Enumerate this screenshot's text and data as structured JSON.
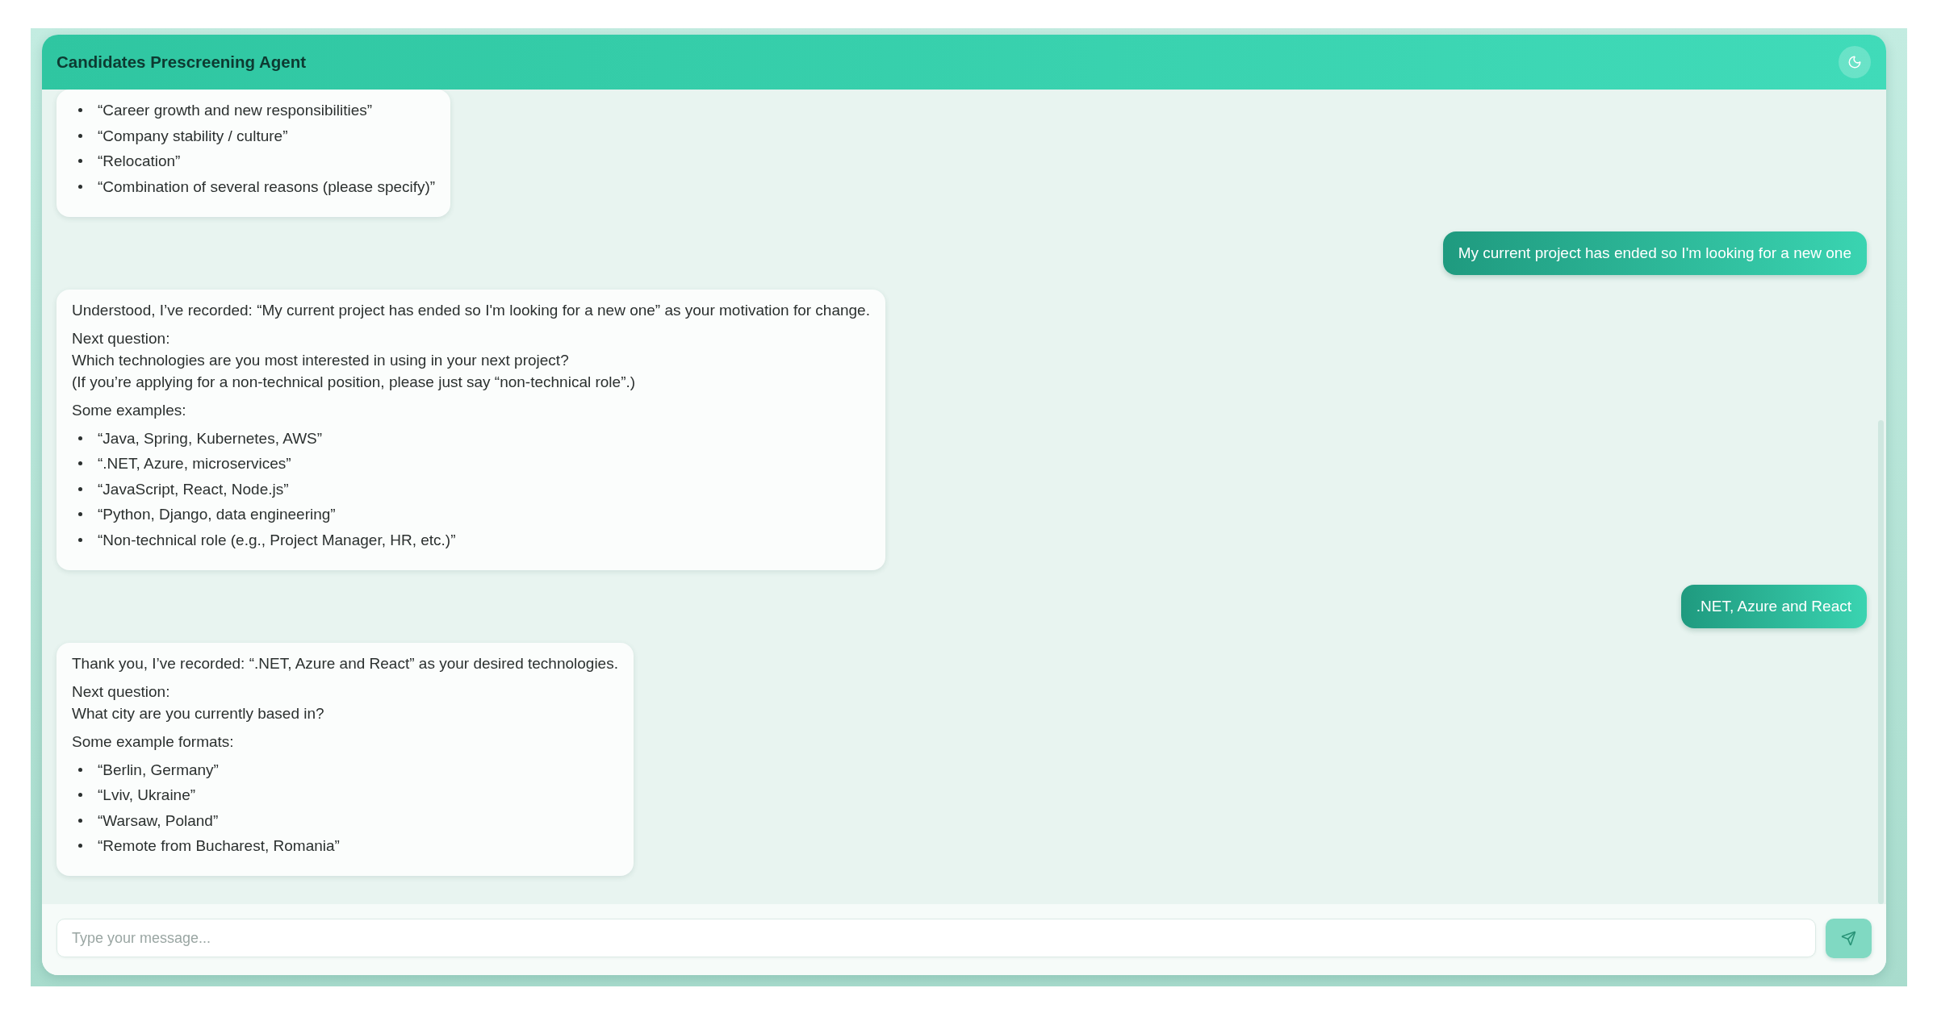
{
  "window": {
    "title": "Candidates Prescreening Agent"
  },
  "messages": [
    {
      "kind": "agent",
      "blocks": [
        {
          "kind": "list",
          "items": [
            "“Career growth and new responsibilities”",
            "“Company stability / culture”",
            "“Relocation”",
            "“Combination of several reasons (please specify)”"
          ]
        }
      ]
    },
    {
      "kind": "user",
      "text": "My current project has ended so I'm looking for a new one"
    },
    {
      "kind": "agent",
      "blocks": [
        {
          "kind": "paragraph",
          "lines": [
            "Understood, I’ve recorded: “My current project has ended so I'm looking for a new one” as your motivation for change."
          ]
        },
        {
          "kind": "paragraph",
          "lines": [
            "Next question:",
            "Which technologies are you most interested in using in your next project?",
            "(If you’re applying for a non-technical position, please just say “non-technical role”.)"
          ]
        },
        {
          "kind": "paragraph",
          "lines": [
            "Some examples:"
          ]
        },
        {
          "kind": "list",
          "items": [
            "“Java, Spring, Kubernetes, AWS”",
            "“.NET, Azure, microservices”",
            "“JavaScript, React, Node.js”",
            "“Python, Django, data engineering”",
            "“Non-technical role (e.g., Project Manager, HR, etc.)”"
          ]
        }
      ]
    },
    {
      "kind": "user",
      "text": ".NET, Azure and React"
    },
    {
      "kind": "agent",
      "blocks": [
        {
          "kind": "paragraph",
          "lines": [
            "Thank you, I’ve recorded: “.NET, Azure and React” as your desired technologies."
          ]
        },
        {
          "kind": "paragraph",
          "lines": [
            "Next question:",
            "What city are you currently based in?"
          ]
        },
        {
          "kind": "paragraph",
          "lines": [
            "Some example formats:"
          ]
        },
        {
          "kind": "list",
          "items": [
            "“Berlin, Germany”",
            "“Lviv, Ukraine”",
            "“Warsaw, Poland”",
            "“Remote from Bucharest, Romania”"
          ]
        }
      ]
    }
  ],
  "composer": {
    "placeholder": "Type your message..."
  }
}
